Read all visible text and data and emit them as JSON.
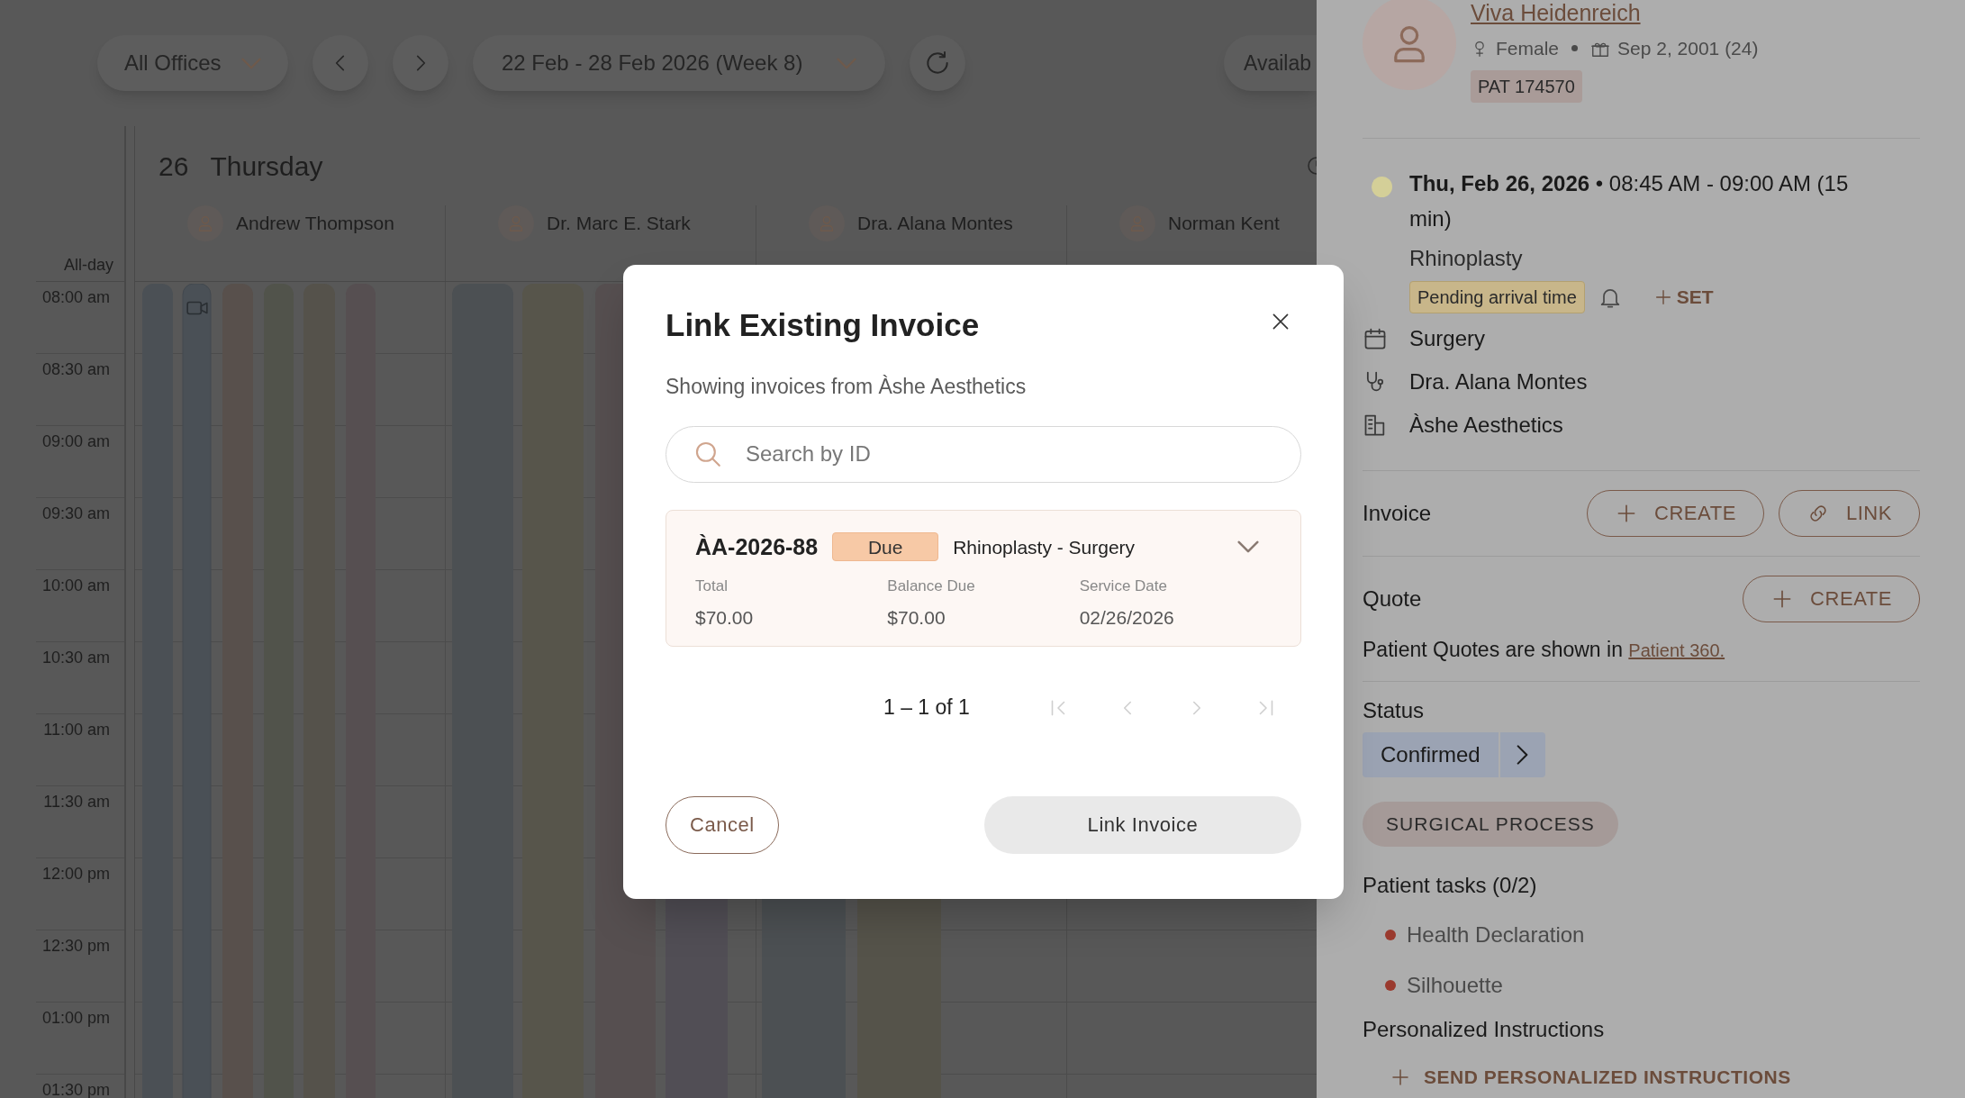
{
  "toolbar": {
    "office_filter": "All Offices",
    "date_range": "22 Feb - 28 Feb 2026 (Week 8)",
    "availability_button": "Availab"
  },
  "day_view": {
    "day_number": "26",
    "day_name": "Thursday",
    "all_day_label": "All-day",
    "providers": [
      "Andrew Thompson",
      "Dr. Marc E. Stark",
      "Dra. Alana Montes",
      "Norman Kent"
    ],
    "times": [
      "08:00 am",
      "08:30 am",
      "09:00 am",
      "09:30 am",
      "10:00 am",
      "10:30 am",
      "11:00 am",
      "11:30 am",
      "12:00 pm",
      "12:30 pm",
      "01:00 pm",
      "01:30 pm"
    ]
  },
  "appointment_panel": {
    "patient_name": "Viva Heidenreich",
    "gender": "Female",
    "birth_date": "Sep 2, 2001 (24)",
    "patient_id": "PAT 174570",
    "date_time": "**Thu, Feb 26, 2026** • 08:45 AM - 09:00 AM (15 min)",
    "procedure": "Rhinoplasty",
    "arrival_badge": "Pending arrival time",
    "set_button": "SET",
    "details": [
      {
        "kind": "category",
        "text": "Surgery"
      },
      {
        "kind": "provider",
        "text": "Dra. Alana Montes"
      },
      {
        "kind": "location",
        "text": "Àshe Aesthetics"
      }
    ],
    "invoice": {
      "label": "Invoice",
      "buttons": [
        {
          "kind": "create",
          "label": "CREATE"
        },
        {
          "kind": "link",
          "label": "LINK"
        }
      ]
    },
    "quote": {
      "label": "Quote",
      "buttons": [
        {
          "kind": "create",
          "label": "CREATE"
        }
      ],
      "note": "Patient Quotes are shown in ",
      "note_link": "Patient 360."
    },
    "status": {
      "label": "Status",
      "value": "Confirmed"
    },
    "process_tag": "SURGICAL PROCESS",
    "tasks_heading": "Patient tasks (0/2)",
    "tasks": [
      "Health Declaration",
      "Silhouette"
    ],
    "instructions_heading": "Personalized Instructions",
    "send_button": "SEND PERSONALIZED INSTRUCTIONS"
  },
  "modal": {
    "title": "Link Existing Invoice",
    "subtitle": "Showing invoices from Àshe Aesthetics",
    "search": {
      "placeholder": "Search by ID"
    },
    "invoices": [
      {
        "id": "ÀA-2026-88",
        "badge": "Due",
        "description": "Rhinoplasty - Surgery",
        "fields": [
          {
            "label": "Total",
            "value": "$70.00"
          },
          {
            "label": "Balance Due",
            "value": "$70.00"
          },
          {
            "label": "Service Date",
            "value": "02/26/2026"
          }
        ]
      }
    ],
    "pagination": {
      "range": "1 – 1 of 1",
      "buttons": [
        {
          "kind": "first",
          "disabled": true
        },
        {
          "kind": "prev",
          "disabled": true
        },
        {
          "kind": "next",
          "disabled": true
        },
        {
          "kind": "last",
          "disabled": true
        }
      ]
    },
    "cancel_button": "Cancel",
    "link_button": {
      "label": "Link Invoice",
      "disabled": true
    }
  }
}
